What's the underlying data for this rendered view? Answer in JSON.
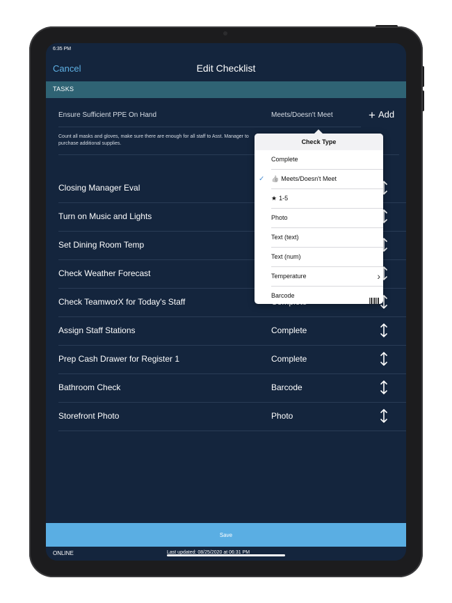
{
  "status": {
    "time": "6:35 PM"
  },
  "nav": {
    "cancel_label": "Cancel",
    "title": "Edit Checklist"
  },
  "section": {
    "label": "TASKS"
  },
  "first_task": {
    "name": "Ensure Sufficient PPE On Hand",
    "type": "Meets/Doesn't Meet",
    "add_label": "Add",
    "description": "Count all masks and gloves, make sure there are enough for all staff to Asst. Manager to purchase additional supplies."
  },
  "tasks": [
    {
      "name": "Closing Manager Eval",
      "type": ""
    },
    {
      "name": "Turn on Music and Lights",
      "type": ""
    },
    {
      "name": "Set Dining Room Temp",
      "type": ""
    },
    {
      "name": "Check Weather Forecast",
      "type": ""
    },
    {
      "name": "Check TeamworX for Today's Staff",
      "type": "Complete"
    },
    {
      "name": "Assign Staff Stations",
      "type": "Complete"
    },
    {
      "name": "Prep Cash Drawer for Register 1",
      "type": "Complete"
    },
    {
      "name": "Bathroom Check",
      "type": "Barcode"
    },
    {
      "name": "Storefront Photo",
      "type": "Photo"
    }
  ],
  "popover": {
    "title": "Check Type",
    "items": [
      {
        "label": "Complete",
        "icon": ""
      },
      {
        "label": "Meets/Doesn't Meet",
        "icon": "thumbs-up-icon",
        "selected": true
      },
      {
        "label": "1-5",
        "icon": "star-icon"
      },
      {
        "label": "Photo",
        "icon": ""
      },
      {
        "label": "Text (text)",
        "icon": ""
      },
      {
        "label": "Text (num)",
        "icon": ""
      },
      {
        "label": "Temperature",
        "icon": "chevron-right-icon"
      },
      {
        "label": "Barcode",
        "icon": "barcode-icon"
      }
    ]
  },
  "save_label": "Save",
  "footer": {
    "online": "ONLINE",
    "updated": "Last updated: 08/25/2020 at 06:31 PM"
  },
  "colors": {
    "background": "#14253d",
    "section": "#2f6374",
    "accent": "#5fb2e6",
    "save": "#5aaee3"
  }
}
